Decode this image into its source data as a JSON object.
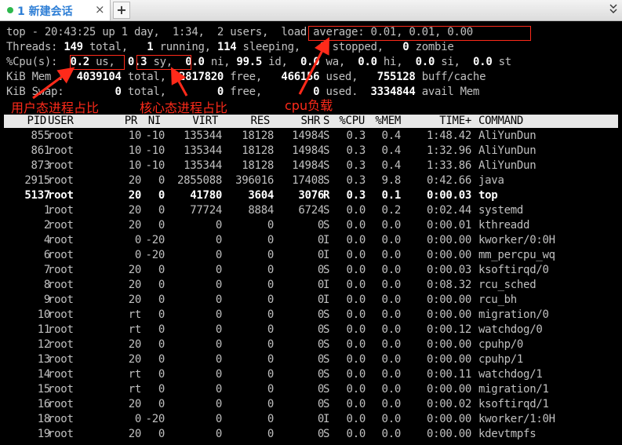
{
  "tab": {
    "index": "1",
    "title": "新建会话",
    "close": "×",
    "add": "+"
  },
  "top_line": {
    "prefix": "top - 20:43:25 up 1 day,  1:34,  2 users,  ",
    "load": "load average: 0.01, 0.01, 0.00"
  },
  "threads_line": {
    "label": "Threads: ",
    "total": "149",
    "t1": " total,   ",
    "running": "1",
    "t2": " running, ",
    "sleeping": "114",
    "t3": " sleeping,   ",
    "stopped": "0",
    "t4": " stopped,   ",
    "zombie": "0",
    "t5": " zombie"
  },
  "cpu_line": {
    "label": "%Cpu(s):  ",
    "us": "0.2",
    "t1": " us,  ",
    "sy": "0.3",
    "t2": " sy,  ",
    "ni": "0.0",
    "t3": " ni, ",
    "id": "99.5",
    "t4": " id,  ",
    "wa": "0.0",
    "t5": " wa,  ",
    "hi": "0.0",
    "t6": " hi,  ",
    "si": "0.0",
    "t7": " si,  ",
    "st": "0.0",
    "t8": " st"
  },
  "mem_line": {
    "label": "KiB Mem :  ",
    "total": "4039104",
    "t1": " total,  ",
    "free": "2817820",
    "t2": " free,   ",
    "used": "466156",
    "t3": " used,   ",
    "buff": "755128",
    "t4": " buff/cache"
  },
  "swap_line": {
    "label": "KiB Swap:        ",
    "total": "0",
    "t1": " total,        ",
    "free": "0",
    "t2": " free,        ",
    "used": "0",
    "t3": " used.  ",
    "avail": "3334844",
    "t4": " avail Mem"
  },
  "columns": {
    "pid": "PID",
    "user": "USER",
    "pr": "PR",
    "ni": "NI",
    "virt": "VIRT",
    "res": "RES",
    "shr": "SHR",
    "s": "S",
    "cpu": "%CPU",
    "mem": "%MEM",
    "time": "TIME+",
    "command": "COMMAND"
  },
  "processes": [
    {
      "pid": "855",
      "user": "root",
      "pr": "10",
      "ni": "-10",
      "virt": "135344",
      "res": "18128",
      "shr": "14984",
      "s": "S",
      "cpu": "0.3",
      "mem": "0.4",
      "time": "1:48.42",
      "command": "AliYunDun"
    },
    {
      "pid": "861",
      "user": "root",
      "pr": "10",
      "ni": "-10",
      "virt": "135344",
      "res": "18128",
      "shr": "14984",
      "s": "S",
      "cpu": "0.3",
      "mem": "0.4",
      "time": "1:32.96",
      "command": "AliYunDun"
    },
    {
      "pid": "873",
      "user": "root",
      "pr": "10",
      "ni": "-10",
      "virt": "135344",
      "res": "18128",
      "shr": "14984",
      "s": "S",
      "cpu": "0.3",
      "mem": "0.4",
      "time": "1:33.86",
      "command": "AliYunDun"
    },
    {
      "pid": "2915",
      "user": "root",
      "pr": "20",
      "ni": "0",
      "virt": "2855088",
      "res": "396016",
      "shr": "17408",
      "s": "S",
      "cpu": "0.3",
      "mem": "9.8",
      "time": "0:42.66",
      "command": "java"
    },
    {
      "pid": "5137",
      "user": "root",
      "pr": "20",
      "ni": "0",
      "virt": "41780",
      "res": "3604",
      "shr": "3076",
      "s": "R",
      "cpu": "0.3",
      "mem": "0.1",
      "time": "0:00.03",
      "command": "top"
    },
    {
      "pid": "1",
      "user": "root",
      "pr": "20",
      "ni": "0",
      "virt": "77724",
      "res": "8884",
      "shr": "6724",
      "s": "S",
      "cpu": "0.0",
      "mem": "0.2",
      "time": "0:02.44",
      "command": "systemd"
    },
    {
      "pid": "2",
      "user": "root",
      "pr": "20",
      "ni": "0",
      "virt": "0",
      "res": "0",
      "shr": "0",
      "s": "S",
      "cpu": "0.0",
      "mem": "0.0",
      "time": "0:00.01",
      "command": "kthreadd"
    },
    {
      "pid": "4",
      "user": "root",
      "pr": "0",
      "ni": "-20",
      "virt": "0",
      "res": "0",
      "shr": "0",
      "s": "I",
      "cpu": "0.0",
      "mem": "0.0",
      "time": "0:00.00",
      "command": "kworker/0:0H"
    },
    {
      "pid": "6",
      "user": "root",
      "pr": "0",
      "ni": "-20",
      "virt": "0",
      "res": "0",
      "shr": "0",
      "s": "I",
      "cpu": "0.0",
      "mem": "0.0",
      "time": "0:00.00",
      "command": "mm_percpu_wq"
    },
    {
      "pid": "7",
      "user": "root",
      "pr": "20",
      "ni": "0",
      "virt": "0",
      "res": "0",
      "shr": "0",
      "s": "S",
      "cpu": "0.0",
      "mem": "0.0",
      "time": "0:00.03",
      "command": "ksoftirqd/0"
    },
    {
      "pid": "8",
      "user": "root",
      "pr": "20",
      "ni": "0",
      "virt": "0",
      "res": "0",
      "shr": "0",
      "s": "I",
      "cpu": "0.0",
      "mem": "0.0",
      "time": "0:08.32",
      "command": "rcu_sched"
    },
    {
      "pid": "9",
      "user": "root",
      "pr": "20",
      "ni": "0",
      "virt": "0",
      "res": "0",
      "shr": "0",
      "s": "I",
      "cpu": "0.0",
      "mem": "0.0",
      "time": "0:00.00",
      "command": "rcu_bh"
    },
    {
      "pid": "10",
      "user": "root",
      "pr": "rt",
      "ni": "0",
      "virt": "0",
      "res": "0",
      "shr": "0",
      "s": "S",
      "cpu": "0.0",
      "mem": "0.0",
      "time": "0:00.00",
      "command": "migration/0"
    },
    {
      "pid": "11",
      "user": "root",
      "pr": "rt",
      "ni": "0",
      "virt": "0",
      "res": "0",
      "shr": "0",
      "s": "S",
      "cpu": "0.0",
      "mem": "0.0",
      "time": "0:00.12",
      "command": "watchdog/0"
    },
    {
      "pid": "12",
      "user": "root",
      "pr": "20",
      "ni": "0",
      "virt": "0",
      "res": "0",
      "shr": "0",
      "s": "S",
      "cpu": "0.0",
      "mem": "0.0",
      "time": "0:00.00",
      "command": "cpuhp/0"
    },
    {
      "pid": "13",
      "user": "root",
      "pr": "20",
      "ni": "0",
      "virt": "0",
      "res": "0",
      "shr": "0",
      "s": "S",
      "cpu": "0.0",
      "mem": "0.0",
      "time": "0:00.00",
      "command": "cpuhp/1"
    },
    {
      "pid": "14",
      "user": "root",
      "pr": "rt",
      "ni": "0",
      "virt": "0",
      "res": "0",
      "shr": "0",
      "s": "S",
      "cpu": "0.0",
      "mem": "0.0",
      "time": "0:00.11",
      "command": "watchdog/1"
    },
    {
      "pid": "15",
      "user": "root",
      "pr": "rt",
      "ni": "0",
      "virt": "0",
      "res": "0",
      "shr": "0",
      "s": "S",
      "cpu": "0.0",
      "mem": "0.0",
      "time": "0:00.00",
      "command": "migration/1"
    },
    {
      "pid": "16",
      "user": "root",
      "pr": "20",
      "ni": "0",
      "virt": "0",
      "res": "0",
      "shr": "0",
      "s": "S",
      "cpu": "0.0",
      "mem": "0.0",
      "time": "0:00.02",
      "command": "ksoftirqd/1"
    },
    {
      "pid": "18",
      "user": "root",
      "pr": "0",
      "ni": "-20",
      "virt": "0",
      "res": "0",
      "shr": "0",
      "s": "I",
      "cpu": "0.0",
      "mem": "0.0",
      "time": "0:00.00",
      "command": "kworker/1:0H"
    },
    {
      "pid": "19",
      "user": "root",
      "pr": "20",
      "ni": "0",
      "virt": "0",
      "res": "0",
      "shr": "0",
      "s": "S",
      "cpu": "0.0",
      "mem": "0.0",
      "time": "0:00.00",
      "command": "kdevtmpfs"
    }
  ],
  "highlight_pid": "5137",
  "annotations": {
    "user_cpu": "用户态进程占比",
    "kernel_cpu": "核心态进程占比",
    "load": "cpu负载",
    "color": "#ff2a1a"
  },
  "colors": {
    "accent": "#2f7fd6",
    "status_dot": "#2db84d",
    "header_bg": "#e8e8e8"
  }
}
